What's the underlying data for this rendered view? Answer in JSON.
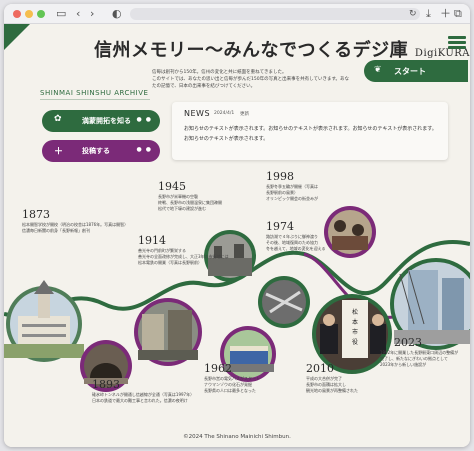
{
  "browser": {
    "dots": [
      "#ee6a5f",
      "#f5be4f",
      "#62c554"
    ],
    "icons": [
      "sidebar-icon",
      "back-icon",
      "forward-icon",
      "contrast-icon",
      "refresh-icon",
      "download-icon",
      "new-tab-icon",
      "tabs-icon"
    ]
  },
  "header": {
    "title": "信州メモリー～みんなでつくるデジ庫",
    "title_sub": "DigiKURA ～",
    "intro_lines": [
      "信毎は創刊から150年。信州の変化と共に紙面を重ねてきました。",
      "このサイトでは、あなたの思い出と信毎が歩んだ150年の写真と出来事を共有していきます。あなたの記憶で、日本の出来事を結びつけてください。"
    ],
    "start_label": "スタート"
  },
  "archive_label": "SHINMAI SHINSHU ARCHIVE",
  "buttons": {
    "explore_label": "満蒙開拓を知る",
    "post_label": "投稿する"
  },
  "news": {
    "heading": "NEWS",
    "date": "2024/4/1",
    "tag": "更新",
    "lines": [
      "お知らせのテキストが表示されます。お知らせのテキストが表示されます。お知らせのテキストが表示されます。",
      "お知らせのテキストが表示されます。"
    ]
  },
  "timeline": [
    {
      "year": "1873",
      "text": [
        "松本開智学校が開校（明治の校舎は1876年。写真は開智）",
        "信濃毎日新聞の前身「長野新報」創刊"
      ]
    },
    {
      "year": "1893",
      "text": [
        "碓氷峠トンネルが開通し信越線が全通（写真は1997年）",
        "日本の鉄道で最大の難工事と言われた。信濃の夜明け"
      ]
    },
    {
      "year": "1914",
      "text": [
        "善光寺の門前町が繁栄する",
        "善光寺の全面改修が完成し、大正3年の市街地には",
        "松本電鉄の開業（写真は長野駅前）"
      ]
    },
    {
      "year": "1945",
      "text": [
        "長野市が米軍機の空襲",
        "終戦、長野市の浅間温泉に集団疎開",
        "松代で地下壕の建設が進む"
      ]
    },
    {
      "year": "1962",
      "text": [
        "長野市営の電気バスがスタート",
        "ナウマンゾウの化石が発掘",
        "長野県の人口は最多となった"
      ]
    },
    {
      "year": "1974",
      "text": [
        "諏訪湖で４年ぶりに御神渡り",
        "その後、地域復興のため協力",
        "冬を越えて、地域の変化を迎える"
      ]
    },
    {
      "year": "1998",
      "text": [
        "長野冬季五輪が開催（写真は",
        "長野駅前の風景）",
        "オリンピック開会の街並みが"
      ]
    },
    {
      "year": "2010",
      "text": [
        "平成の大合併が完了",
        "長野市の面積は拡大し",
        "観光地の風景が再整備された"
      ]
    },
    {
      "year": "2023",
      "text": [
        "1992年に開業した長野駅東口周辺の整備が",
        "完了し、新たなにぎわいの拠点として",
        "2023年から新しい施設が"
      ]
    }
  ],
  "footer": "©2024 The Shinano Mainichi Shimbun.",
  "colors": {
    "green": "#2e6b3f",
    "purple": "#7b2a78",
    "bg": "#f4f2ec"
  }
}
